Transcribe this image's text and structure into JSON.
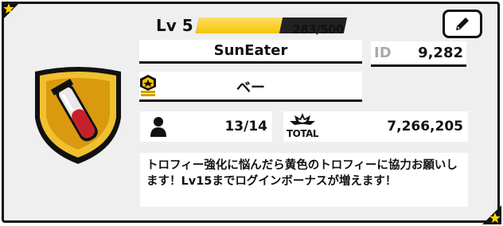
{
  "profile": {
    "level_label": "Lv 5",
    "xp_text": "283/500",
    "xp_fraction": 0.566,
    "name": "SunEater",
    "id_label": "ID",
    "id_value": "9,282",
    "title": "ベー",
    "friends": "13/14",
    "total_label": "TOTAL",
    "total_value": "7,266,205",
    "message": "トロフィー強化に悩んだら黄色のトロフィーに協力お願いします！Lv15までログインボーナスが増えます！"
  },
  "icons": {
    "badge": "gold-shield-test-tube-badge-icon",
    "edit": "pencil-icon",
    "rank": "rank-chevron-icon",
    "friends": "person-icon",
    "total": "total-burst-icon",
    "corners": "star-icon"
  },
  "colors": {
    "xp_fill": "#f5c400",
    "badge_gold": "#e8b020",
    "panel_bg": "#efefef"
  }
}
